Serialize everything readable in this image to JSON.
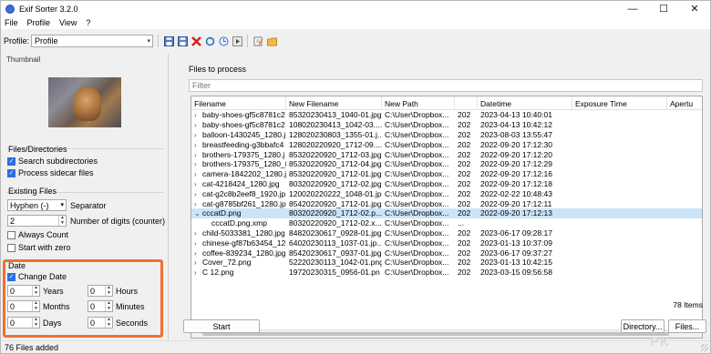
{
  "window": {
    "title": "Exif Sorter 3.2.0",
    "minimize_glyph": "—",
    "maximize_glyph": "☐",
    "close_glyph": "✕"
  },
  "menu": [
    "File",
    "Profile",
    "View",
    "?"
  ],
  "toolbar": {
    "profile_label": "Profile:",
    "profile_value": "Profile",
    "icons": [
      "save-icon",
      "save-as-icon",
      "delete-icon",
      "refresh-icon",
      "clock-icon",
      "play-icon",
      "edit-icon",
      "folder-icon"
    ]
  },
  "left": {
    "thumbnail_label": "Thumbnail",
    "files_dirs": {
      "title": "Files/Directories",
      "search_subdirs": "Search subdirectories",
      "process_sidecar": "Process sidecar files"
    },
    "existing": {
      "title": "Existing Files",
      "mode_value": "Hyphen (-)",
      "separator_label": "Separator",
      "digits_value": "2",
      "digits_label": "Number of digits (counter)",
      "always_count": "Always Count",
      "start_zero": "Start with zero"
    },
    "date": {
      "title": "Date",
      "change_date": "Change Date",
      "years": {
        "value": "0",
        "label": "Years"
      },
      "months": {
        "value": "0",
        "label": "Months"
      },
      "days": {
        "value": "0",
        "label": "Days"
      },
      "hours": {
        "value": "0",
        "label": "Hours"
      },
      "minutes": {
        "value": "0",
        "label": "Minutes"
      },
      "seconds": {
        "value": "0",
        "label": "Seconds"
      }
    }
  },
  "right": {
    "files_label": "Files to process",
    "filter_placeholder": "Filter",
    "columns": [
      "Filename",
      "New Filename",
      "New Path",
      "",
      "Datetime",
      "Exposure Time",
      "Apertu"
    ],
    "rows": [
      {
        "expand": "›",
        "filename": "baby-shoes-gf5c8781c2",
        "new_filename": "85320230413_1040-01.jpg",
        "new_path": "C:\\User\\Dropbox...",
        "p4": "202",
        "datetime": "2023-04-13 10:40:01",
        "indent": false,
        "selected": false
      },
      {
        "expand": "›",
        "filename": "baby-shoes-gf5c8781c2",
        "new_filename": "108020230413_1042-03....",
        "new_path": "C:\\User\\Dropbox...",
        "p4": "202",
        "datetime": "2023-04-13 10:42:12",
        "indent": false,
        "selected": false
      },
      {
        "expand": "›",
        "filename": "balloon-1430245_1280.j",
        "new_filename": "128020230803_1355-01.j...",
        "new_path": "C:\\User\\Dropbox...",
        "p4": "202",
        "datetime": "2023-08-03 13:55:47",
        "indent": false,
        "selected": false
      },
      {
        "expand": "›",
        "filename": "breastfeeding-g3bbafc4",
        "new_filename": "128020220920_1712-09....",
        "new_path": "C:\\User\\Dropbox...",
        "p4": "202",
        "datetime": "2022-09-20 17:12:30",
        "indent": false,
        "selected": false
      },
      {
        "expand": "›",
        "filename": "brothers-179375_1280.j",
        "new_filename": "85320220920_1712-03.jpg",
        "new_path": "C:\\User\\Dropbox...",
        "p4": "202",
        "datetime": "2022-09-20 17:12:20",
        "indent": false,
        "selected": false
      },
      {
        "expand": "›",
        "filename": "brothers-179375_1280_8",
        "new_filename": "85320220920_1712-04.jpg",
        "new_path": "C:\\User\\Dropbox...",
        "p4": "202",
        "datetime": "2022-09-20 17:12:29",
        "indent": false,
        "selected": false
      },
      {
        "expand": "›",
        "filename": "camera-1842202_1280.jp",
        "new_filename": "85320220920_1712-01.jpg",
        "new_path": "C:\\User\\Dropbox...",
        "p4": "202",
        "datetime": "2022-09-20 17:12:16",
        "indent": false,
        "selected": false
      },
      {
        "expand": "›",
        "filename": "cat-4218424_1280.jpg",
        "new_filename": "80320220920_1712-02.jpg",
        "new_path": "C:\\User\\Dropbox...",
        "p4": "202",
        "datetime": "2022-09-20 17:12:18",
        "indent": false,
        "selected": false
      },
      {
        "expand": "›",
        "filename": "cat-g2c8b2eef8_1920.jp",
        "new_filename": "120020220222_1048-01.jpg",
        "new_path": "C:\\User\\Dropbox...",
        "p4": "202",
        "datetime": "2022-02-22 10:48:43",
        "indent": false,
        "selected": false
      },
      {
        "expand": "›",
        "filename": "cat-g8785bf261_1280.jp",
        "new_filename": "85420220920_1712-01.jpg",
        "new_path": "C:\\User\\Dropbox...",
        "p4": "202",
        "datetime": "2022-09-20 17:12:11",
        "indent": false,
        "selected": false
      },
      {
        "expand": "⌄",
        "filename": "cccatD.png",
        "new_filename": "80320220920_1712-02.p...",
        "new_path": "C:\\User\\Dropbox...",
        "p4": "202",
        "datetime": "2022-09-20 17:12:13",
        "indent": false,
        "selected": true
      },
      {
        "expand": "",
        "filename": "cccatD.png.xmp",
        "new_filename": "80320220920_1712-02.x...",
        "new_path": "C:\\User\\Dropbox...",
        "p4": "...",
        "datetime": "",
        "indent": true,
        "selected": false
      },
      {
        "expand": "›",
        "filename": "child-5033381_1280.jpg",
        "new_filename": "84820230617_0928-01.jpg",
        "new_path": "C:\\User\\Dropbox...",
        "p4": "202",
        "datetime": "2023-06-17 09:28:17",
        "indent": false,
        "selected": false
      },
      {
        "expand": "›",
        "filename": "chinese-gf87b63454_12(",
        "new_filename": "64020230113_1037-01.jp...",
        "new_path": "C:\\User\\Dropbox...",
        "p4": "202",
        "datetime": "2023-01-13 10:37:09",
        "indent": false,
        "selected": false
      },
      {
        "expand": "›",
        "filename": "coffee-839234_1280.jpg",
        "new_filename": "85420230617_0937-01.jpg",
        "new_path": "C:\\User\\Dropbox...",
        "p4": "202",
        "datetime": "2023-06-17 09:37:27",
        "indent": false,
        "selected": false
      },
      {
        "expand": "›",
        "filename": "Cover_72.png",
        "new_filename": "52220230113_1042-01.png",
        "new_path": "C:\\User\\Dropbox...",
        "p4": "202",
        "datetime": "2023-01-13 10:42:15",
        "indent": false,
        "selected": false
      },
      {
        "expand": "›",
        "filename": "C 12.png",
        "new_filename": "19720230315_0956-01.pn",
        "new_path": "C:\\User\\Dropbox...",
        "p4": "202",
        "datetime": "2023-03-15 09:56:58",
        "indent": false,
        "selected": false
      }
    ],
    "count": "78 Items",
    "start_button": "Start",
    "directory_button": "Directory...",
    "files_button": "Files..."
  },
  "status": "76 Files added",
  "watermark": "PK"
}
